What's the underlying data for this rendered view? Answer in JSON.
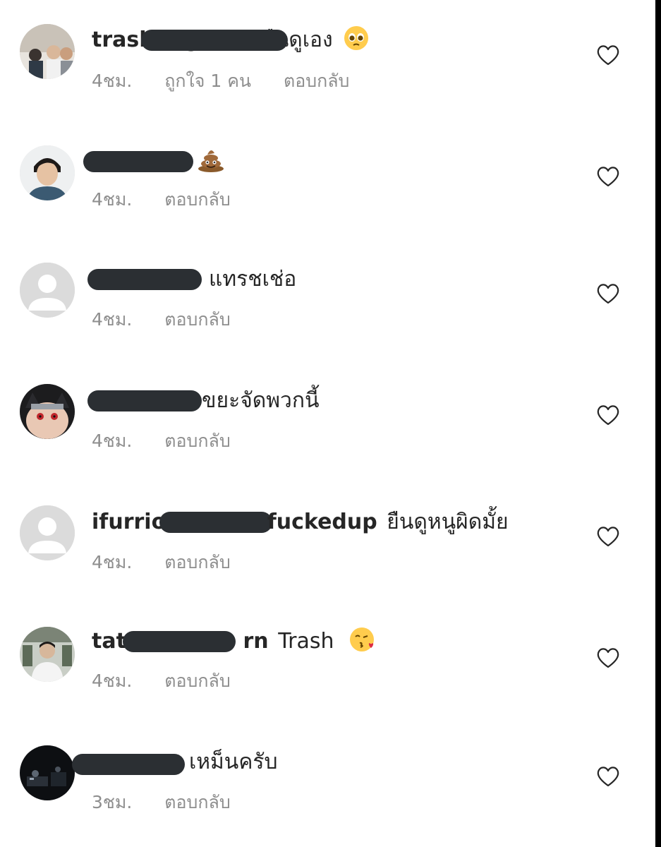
{
  "comments": [
    {
      "username": "trashbng",
      "text": "ผมแค่ยืนดูเอง",
      "emoji": "pleading-face",
      "time": "4ชม.",
      "likes": "ถูกใจ 1 คน",
      "reply": "ตอบกลับ"
    },
    {
      "username": "",
      "text": "",
      "emoji": "pile-of-poo",
      "time": "4ชม.",
      "reply": "ตอบกลับ"
    },
    {
      "username": "",
      "text": "แทรชเช่อ",
      "time": "4ชม.",
      "reply": "ตอบกลับ"
    },
    {
      "username": "",
      "text": "ขยะจัดพวกนี้",
      "time": "4ชม.",
      "reply": "ตอบกลับ"
    },
    {
      "username": "ifurrio",
      "username_end": "fuckedup",
      "text": "ยืนดูหนูผิดมั้ย",
      "time": "4ชม.",
      "reply": "ตอบกลับ"
    },
    {
      "username": "tat",
      "username_end": "rn",
      "text": "Trash",
      "emoji": "face-blowing-a-kiss",
      "time": "4ชม.",
      "reply": "ตอบกลับ"
    },
    {
      "username": "",
      "text": "เหม็นครับ",
      "time": "3ชม.",
      "reply": "ตอบกลับ"
    }
  ],
  "icons": {
    "like": "heart-outline-icon"
  },
  "colors": {
    "text": "#262626",
    "meta": "#8e8e8e",
    "redaction": "#2b2f33"
  }
}
